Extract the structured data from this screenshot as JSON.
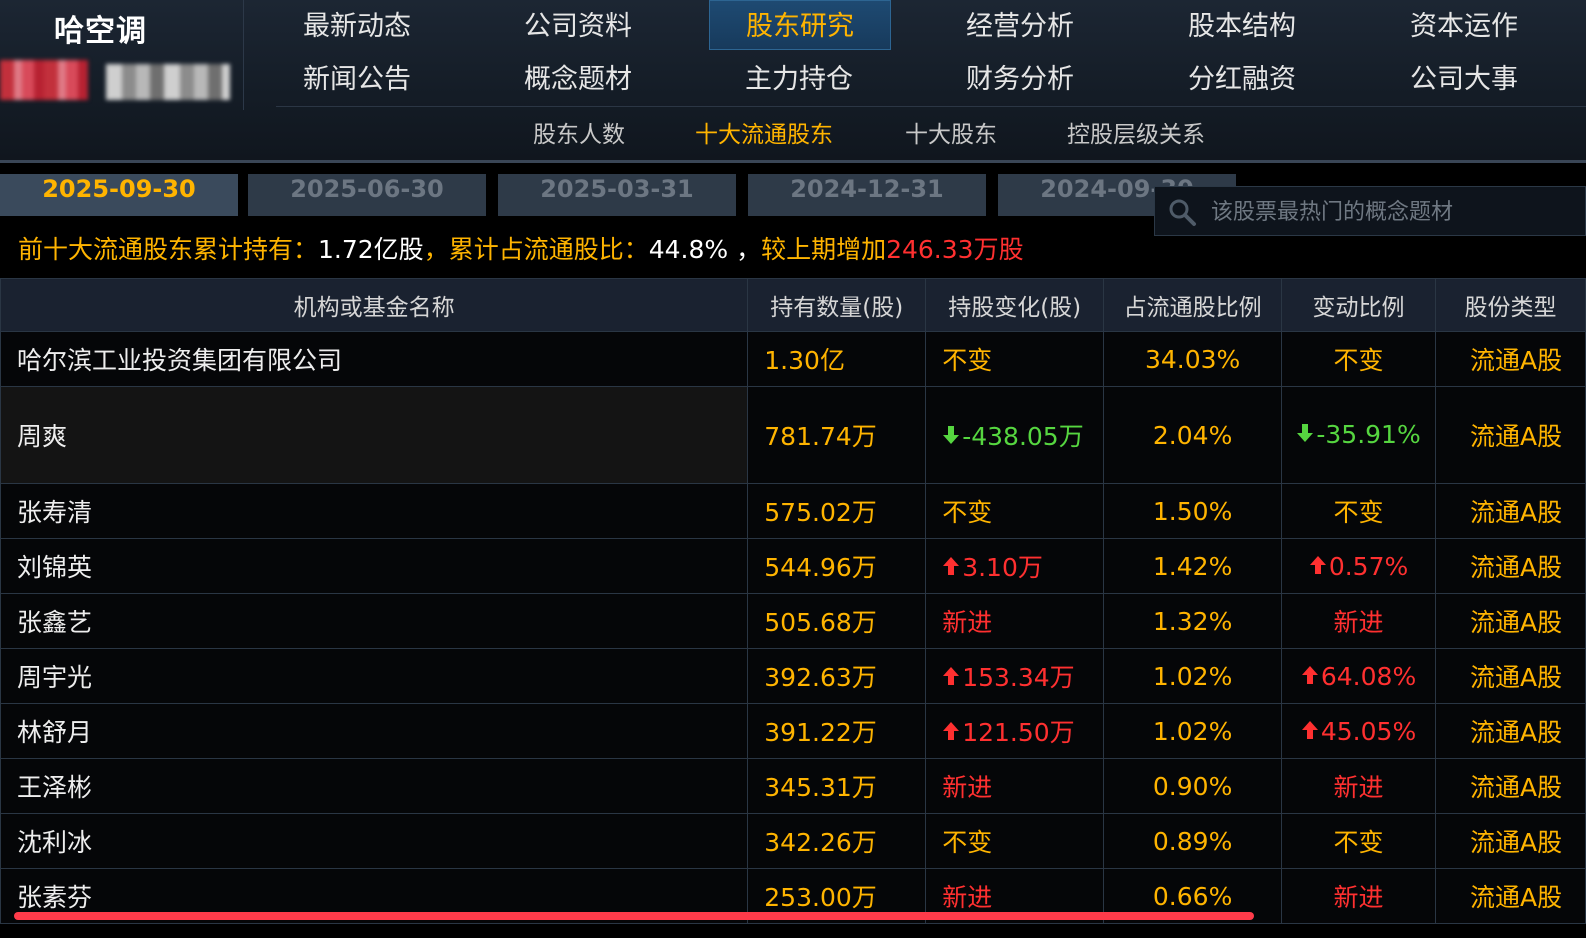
{
  "stock": {
    "name": "哈空调"
  },
  "nav": {
    "rows": [
      [
        "最新动态",
        "公司资料",
        "股东研究",
        "经营分析",
        "股本结构",
        "资本运作"
      ],
      [
        "新闻公告",
        "概念题材",
        "主力持仓",
        "财务分析",
        "分红融资",
        "公司大事"
      ]
    ],
    "active": "股东研究"
  },
  "sub_tabs": [
    "股东人数",
    "十大流通股东",
    "十大股东",
    "控股层级关系"
  ],
  "sub_tab_active": "十大流通股东",
  "date_tabs": [
    "2025-09-30",
    "2025-06-30",
    "2025-03-31",
    "2024-12-31",
    "2024-09-30"
  ],
  "search": {
    "placeholder": "该股票最热门的概念题材"
  },
  "summary": {
    "label1": "前十大流通股东累计持有：",
    "value1": "1.72亿股",
    "label2": "，累计占流通股比：",
    "value2": "44.8% ，",
    "label3": "较上期增加",
    "value3": "246.33万股"
  },
  "table": {
    "headers": [
      "机构或基金名称",
      "持有数量(股)",
      "持股变化(股)",
      "占流通股比例",
      "变动比例",
      "股份类型"
    ],
    "rows": [
      {
        "name": "哈尔滨工业投资集团有限公司",
        "amount": "1.30亿",
        "change": "不变",
        "change_dir": "same",
        "pct": "34.03%",
        "ratio": "不变",
        "ratio_dir": "same",
        "type": "流通A股"
      },
      {
        "name": "周爽",
        "amount": "781.74万",
        "change": "-438.05万",
        "change_dir": "down",
        "pct": "2.04%",
        "ratio": "-35.91%",
        "ratio_dir": "down",
        "type": "流通A股"
      },
      {
        "name": "张寿清",
        "amount": "575.02万",
        "change": "不变",
        "change_dir": "same",
        "pct": "1.50%",
        "ratio": "不变",
        "ratio_dir": "same",
        "type": "流通A股"
      },
      {
        "name": "刘锦英",
        "amount": "544.96万",
        "change": "3.10万",
        "change_dir": "up",
        "pct": "1.42%",
        "ratio": "0.57%",
        "ratio_dir": "up",
        "type": "流通A股"
      },
      {
        "name": "张鑫艺",
        "amount": "505.68万",
        "change": "新进",
        "change_dir": "new",
        "pct": "1.32%",
        "ratio": "新进",
        "ratio_dir": "new",
        "type": "流通A股"
      },
      {
        "name": "周宇光",
        "amount": "392.63万",
        "change": "153.34万",
        "change_dir": "up",
        "pct": "1.02%",
        "ratio": "64.08%",
        "ratio_dir": "up",
        "type": "流通A股"
      },
      {
        "name": "林舒月",
        "amount": "391.22万",
        "change": "121.50万",
        "change_dir": "up",
        "pct": "1.02%",
        "ratio": "45.05%",
        "ratio_dir": "up",
        "type": "流通A股"
      },
      {
        "name": "王泽彬",
        "amount": "345.31万",
        "change": "新进",
        "change_dir": "new",
        "pct": "0.90%",
        "ratio": "新进",
        "ratio_dir": "new",
        "type": "流通A股"
      },
      {
        "name": "沈利冰",
        "amount": "342.26万",
        "change": "不变",
        "change_dir": "same",
        "pct": "0.89%",
        "ratio": "不变",
        "ratio_dir": "same",
        "type": "流通A股"
      },
      {
        "name": "张素芬",
        "amount": "253.00万",
        "change": "新进",
        "change_dir": "new",
        "pct": "0.66%",
        "ratio": "新进",
        "ratio_dir": "new",
        "type": "流通A股"
      }
    ]
  },
  "colors": {
    "accent": "#ffb400",
    "up": "#ff3030",
    "down": "#56d640",
    "active_nav": "#1e4a72"
  },
  "icons": {
    "search": "search-icon",
    "up": "arrow-up-icon",
    "down": "arrow-down-icon"
  }
}
